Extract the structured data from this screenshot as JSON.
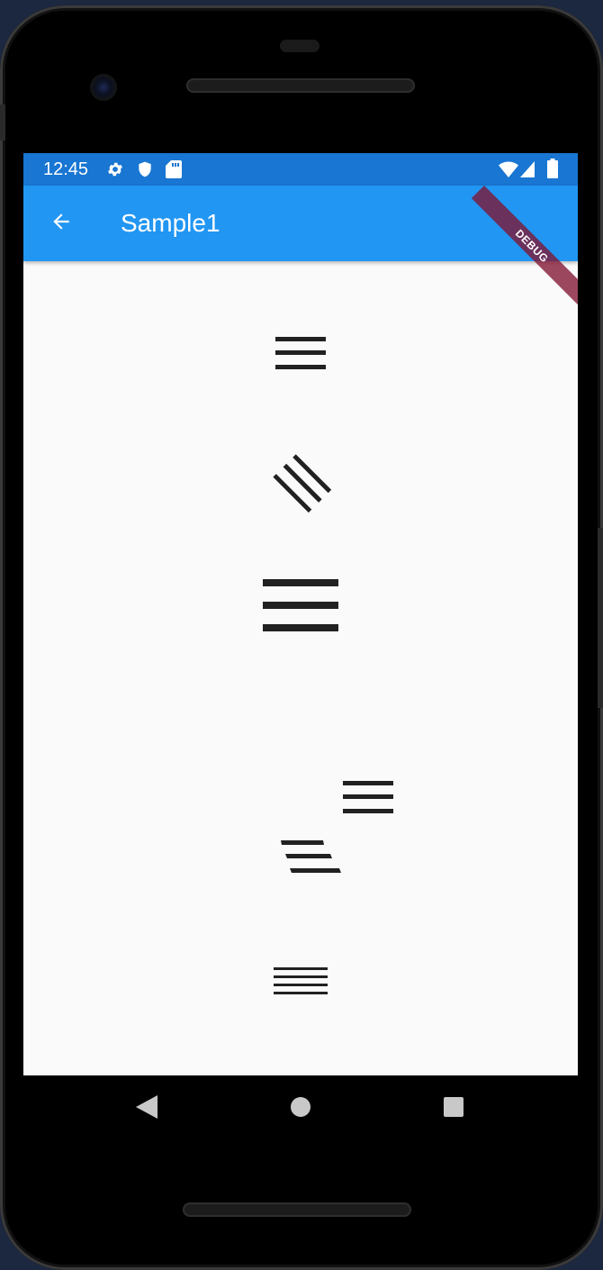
{
  "status_bar": {
    "time": "12:45",
    "left_icons": [
      "gear-icon",
      "shield-icon",
      "sd-card-icon"
    ],
    "right_icons": [
      "wifi-icon",
      "signal-icon",
      "battery-icon"
    ]
  },
  "app_bar": {
    "title": "Sample1",
    "back_icon": "arrow-back-icon",
    "color": "#2196f3"
  },
  "debug_banner": {
    "label": "DEBUG"
  },
  "content": {
    "icons": [
      {
        "name": "menu-icon",
        "variant": "default"
      },
      {
        "name": "menu-icon",
        "variant": "rotated"
      },
      {
        "name": "menu-icon",
        "variant": "large"
      },
      {
        "name": "menu-icon",
        "variant": "offset"
      },
      {
        "name": "menu-icon",
        "variant": "skewed"
      },
      {
        "name": "menu-icon",
        "variant": "scaled-y"
      }
    ]
  },
  "nav_bar": {
    "buttons": [
      "back-triangle-icon",
      "home-circle-icon",
      "recents-square-icon"
    ]
  },
  "colors": {
    "status_bar": "#1976d2",
    "app_bar": "#2196f3",
    "background": "#fafafa",
    "icon": "#212121"
  }
}
